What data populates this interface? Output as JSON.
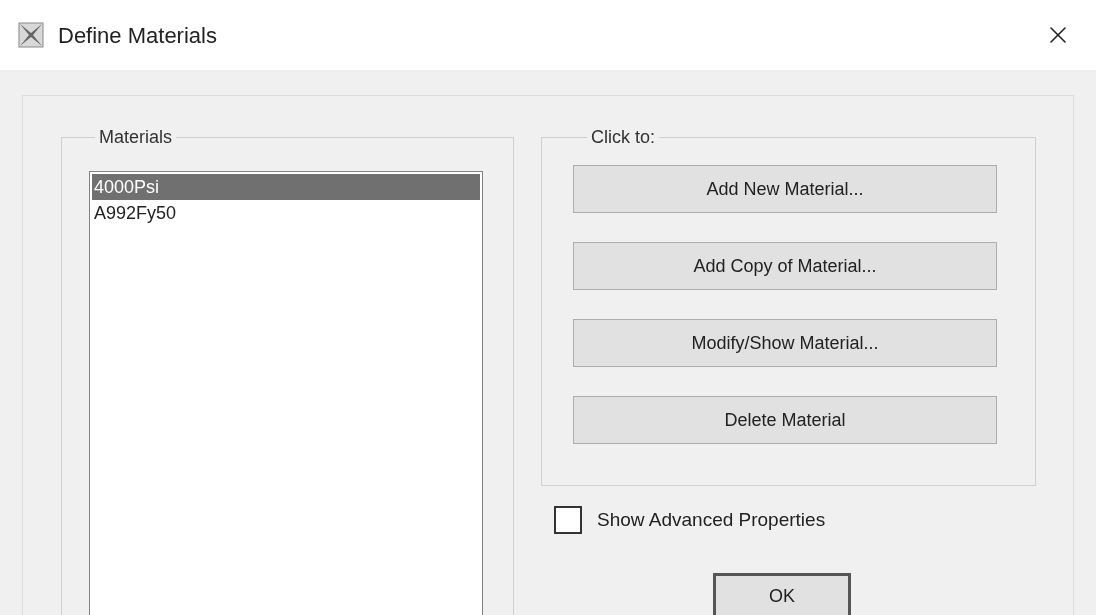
{
  "window": {
    "title": "Define Materials"
  },
  "materials": {
    "label": "Materials",
    "items": [
      {
        "name": "4000Psi",
        "selected": true
      },
      {
        "name": "A992Fy50",
        "selected": false
      }
    ]
  },
  "actions": {
    "label": "Click to:",
    "buttons": [
      "Add New Material...",
      "Add Copy of Material...",
      "Modify/Show Material...",
      "Delete Material"
    ]
  },
  "show_advanced": {
    "label": "Show Advanced Properties",
    "checked": false
  },
  "ok_button": "OK"
}
